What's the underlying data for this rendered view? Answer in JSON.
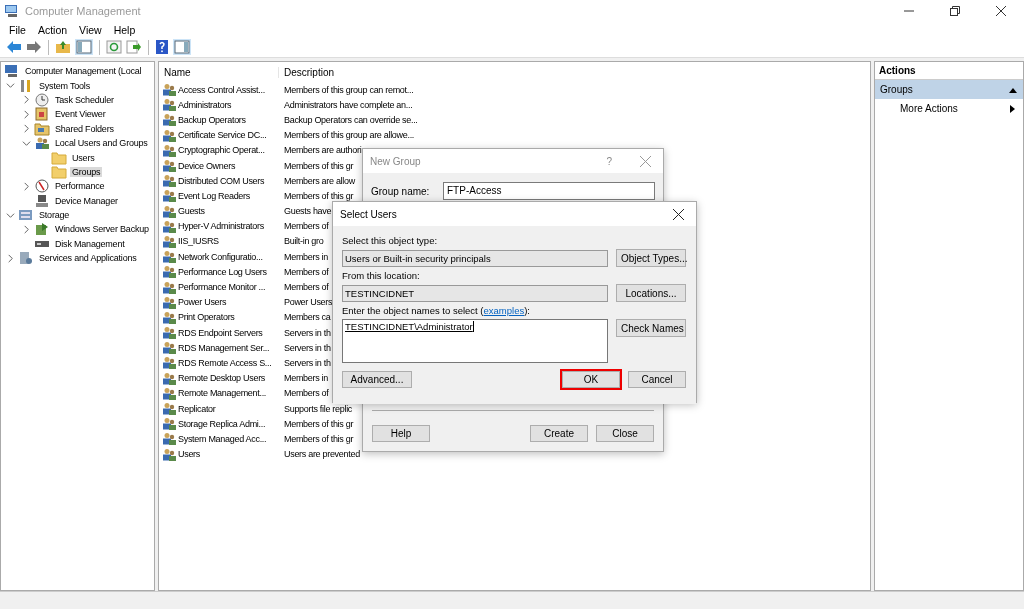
{
  "window": {
    "title": "Computer Management"
  },
  "menu": [
    "File",
    "Action",
    "View",
    "Help"
  ],
  "tree": [
    {
      "label": "Computer Management (Local",
      "kind": "computer",
      "selected": false,
      "children": [
        {
          "label": "System Tools",
          "kind": "tools",
          "expanded": true,
          "selected": false,
          "children": [
            {
              "label": "Task Scheduler",
              "kind": "clock",
              "expanded": false,
              "selected": false
            },
            {
              "label": "Event Viewer",
              "kind": "log",
              "expanded": false,
              "selected": false
            },
            {
              "label": "Shared Folders",
              "kind": "share",
              "expanded": false,
              "selected": false
            },
            {
              "label": "Local Users and Groups",
              "kind": "users",
              "expanded": true,
              "selected": false,
              "children": [
                {
                  "label": "Users",
                  "kind": "folder",
                  "selected": false
                },
                {
                  "label": "Groups",
                  "kind": "folder",
                  "selected": true
                }
              ]
            },
            {
              "label": "Performance",
              "kind": "gauge",
              "expanded": false,
              "selected": false
            },
            {
              "label": "Device Manager",
              "kind": "device",
              "selected": false
            }
          ]
        },
        {
          "label": "Storage",
          "kind": "storage",
          "expanded": true,
          "selected": false,
          "children": [
            {
              "label": "Windows Server Backup",
              "kind": "backup",
              "expanded": false,
              "selected": false
            },
            {
              "label": "Disk Management",
              "kind": "disk",
              "selected": false
            }
          ]
        },
        {
          "label": "Services and Applications",
          "kind": "services",
          "expanded": false,
          "selected": false
        }
      ]
    }
  ],
  "table": {
    "columns": [
      "Name",
      "Description"
    ],
    "rows": [
      {
        "name": "Access Control Assist...",
        "description": "Members of this group can remot..."
      },
      {
        "name": "Administrators",
        "description": "Administrators have complete an..."
      },
      {
        "name": "Backup Operators",
        "description": "Backup Operators can override se..."
      },
      {
        "name": "Certificate Service DC...",
        "description": "Members of this group are allowe..."
      },
      {
        "name": "Cryptographic Operat...",
        "description": "Members are authori"
      },
      {
        "name": "Device Owners",
        "description": "Members of this gr"
      },
      {
        "name": "Distributed COM Users",
        "description": "Members are allow"
      },
      {
        "name": "Event Log Readers",
        "description": "Members of this gr"
      },
      {
        "name": "Guests",
        "description": "Guests have"
      },
      {
        "name": "Hyper-V Administrators",
        "description": "Members of"
      },
      {
        "name": "IIS_IUSRS",
        "description": "Built-in gro"
      },
      {
        "name": "Network Configuratio...",
        "description": "Members in"
      },
      {
        "name": "Performance Log Users",
        "description": "Members of"
      },
      {
        "name": "Performance Monitor ...",
        "description": "Members of"
      },
      {
        "name": "Power Users",
        "description": "Power Users"
      },
      {
        "name": "Print Operators",
        "description": "Members ca"
      },
      {
        "name": "RDS Endpoint Servers",
        "description": "Servers in th"
      },
      {
        "name": "RDS Management Ser...",
        "description": "Servers in th"
      },
      {
        "name": "RDS Remote Access S...",
        "description": "Servers in th"
      },
      {
        "name": "Remote Desktop Users",
        "description": "Members in"
      },
      {
        "name": "Remote Management...",
        "description": "Members of"
      },
      {
        "name": "Replicator",
        "description": "Supports file replic"
      },
      {
        "name": "Storage Replica Admi...",
        "description": "Members of this gr"
      },
      {
        "name": "System Managed Acc...",
        "description": "Members of this gr"
      },
      {
        "name": "Users",
        "description": "Users are prevented"
      }
    ]
  },
  "actions": {
    "title": "Actions",
    "section": "Groups",
    "expanded": true,
    "items": [
      "More Actions"
    ]
  },
  "new_group_dialog": {
    "title": "New Group",
    "help": "?",
    "group_name_label": "Group name:",
    "group_name": "FTP-Access",
    "buttons": [
      "Help",
      "Create",
      "Close"
    ]
  },
  "select_users_dialog": {
    "title": "Select Users",
    "object_type_label": "Select this object type:",
    "object_type": "Users or Built-in security principals",
    "object_types_button": "Object Types...",
    "location_label": "From this location:",
    "location": "TESTINCIDNET",
    "locations_button": "Locations...",
    "names_label": "Enter the object names to select (",
    "names_link": "examples",
    "names_label_end": "):",
    "names": "TESTINCIDNET\\Administrator",
    "check_names_button": "Check Names",
    "buttons": [
      {
        "label": "Advanced...",
        "highlighted": false
      },
      {
        "label": "OK",
        "highlighted": true
      },
      {
        "label": "Cancel",
        "highlighted": false
      }
    ]
  }
}
